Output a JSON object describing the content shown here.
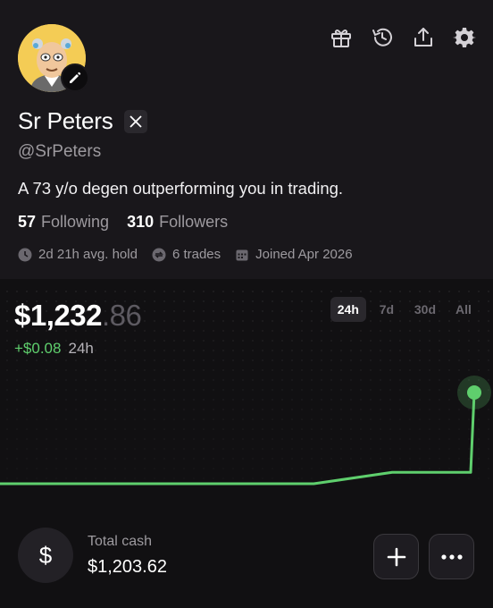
{
  "profile": {
    "name": "Sr Peters",
    "handle": "@SrPeters",
    "bio": "A 73 y/o degen outperforming you in trading.",
    "following_count": "57",
    "following_label": "Following",
    "followers_count": "310",
    "followers_label": "Followers",
    "avg_hold": "2d 21h avg. hold",
    "trades": "6 trades",
    "joined": "Joined Apr 2026"
  },
  "header_icons": [
    "gift-icon",
    "history-icon",
    "share-icon",
    "settings-icon"
  ],
  "portfolio": {
    "balance_main": "$1,232",
    "balance_decimals": ".86",
    "change": "+$0.08",
    "change_period": "24h",
    "ranges": [
      "24h",
      "7d",
      "30d",
      "All"
    ],
    "active_range": "24h"
  },
  "chart_data": {
    "type": "line",
    "series": [
      {
        "values": [
          1232.78,
          1232.78,
          1232.78,
          1232.78,
          1232.78,
          1232.79,
          1232.79,
          1232.86
        ]
      }
    ]
  },
  "cash": {
    "label": "Total cash",
    "value": "$1,203.62",
    "icon_symbol": "$"
  },
  "actions": {
    "add_symbol": "+",
    "more_symbol": "•••"
  },
  "colors": {
    "accent_green": "#5fcf6d",
    "background": "#111012",
    "profile_bg": "#19171b"
  }
}
